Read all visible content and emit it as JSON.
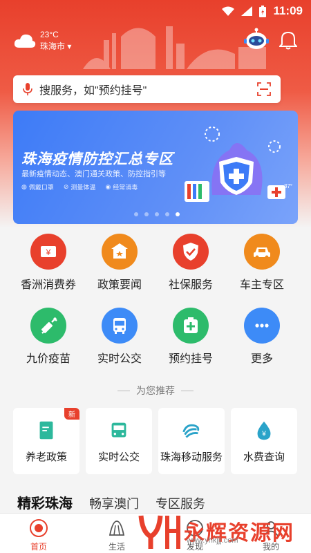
{
  "status_bar": {
    "time": "11:09"
  },
  "weather": {
    "temperature": "23°C",
    "city": "珠海市"
  },
  "search": {
    "placeholder": "搜服务，如\"预约挂号\""
  },
  "banner": {
    "title": "珠海疫情防控汇总专区",
    "subtitle": "最新疫情动态、澳门通关政策、防控指引等",
    "tags": [
      "佩戴口罩",
      "测量体温",
      "经常消毒"
    ],
    "thermo_label": "37°",
    "page_count": 5,
    "active_page": 4
  },
  "services": [
    {
      "label": "香洲消费券",
      "icon": "coupon-icon",
      "color": "#e8402c"
    },
    {
      "label": "政策要闻",
      "icon": "building-icon",
      "color": "#f08a1c"
    },
    {
      "label": "社保服务",
      "icon": "shield-check-icon",
      "color": "#e8402c"
    },
    {
      "label": "车主专区",
      "icon": "car-icon",
      "color": "#f08a1c"
    },
    {
      "label": "九价疫苗",
      "icon": "syringe-icon",
      "color": "#2dbb6b"
    },
    {
      "label": "实时公交",
      "icon": "bus-icon",
      "color": "#3d8bf7"
    },
    {
      "label": "预约挂号",
      "icon": "medical-kit-icon",
      "color": "#2dbb6b"
    },
    {
      "label": "更多",
      "icon": "more-icon",
      "color": "#3d8bf7"
    }
  ],
  "recommend": {
    "title": "为您推荐",
    "cards": [
      {
        "label": "养老政策",
        "icon": "book-icon",
        "badge": "新"
      },
      {
        "label": "实时公交",
        "icon": "bus-icon",
        "badge": ""
      },
      {
        "label": "珠海移动服务",
        "icon": "china-mobile-icon",
        "badge": ""
      },
      {
        "label": "水费查询",
        "icon": "water-drop-icon",
        "badge": ""
      }
    ]
  },
  "section_tabs": [
    "精彩珠海",
    "畅享澳门",
    "专区服务"
  ],
  "bottom_nav": [
    {
      "label": "首页",
      "icon": "home-shell-icon",
      "active": true
    },
    {
      "label": "生活",
      "icon": "life-icon",
      "active": false
    },
    {
      "label": "发现",
      "icon": "discover-icon",
      "active": false
    },
    {
      "label": "我的",
      "icon": "user-icon",
      "active": false
    }
  ],
  "watermark": {
    "text": "永辉资源网",
    "url": "www.yhkjjj.com"
  },
  "colors": {
    "brand_red": "#e8402c",
    "banner_blue": "#3d7bf7"
  }
}
